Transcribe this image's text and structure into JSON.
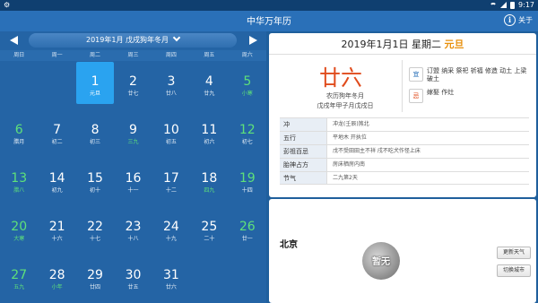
{
  "status_bar": {
    "left_icon": "settings-icon",
    "time": "9:17"
  },
  "header": {
    "title": "中华万年历",
    "about_label": "关于"
  },
  "calendar": {
    "month_label": "2019年1月 戊戌狗年冬月",
    "weekdays": [
      "周日",
      "周一",
      "周二",
      "周三",
      "周四",
      "周五",
      "周六"
    ],
    "weeks": [
      [
        null,
        null,
        {
          "day": "1",
          "sub": "元旦",
          "selected": true
        },
        {
          "day": "2",
          "sub": "廿七"
        },
        {
          "day": "3",
          "sub": "廿八"
        },
        {
          "day": "4",
          "sub": "廿九"
        },
        {
          "day": "5",
          "sub": "小寒",
          "term": true
        }
      ],
      [
        {
          "day": "6",
          "sub": "腊月"
        },
        {
          "day": "7",
          "sub": "初二"
        },
        {
          "day": "8",
          "sub": "初三"
        },
        {
          "day": "9",
          "sub": "三九",
          "term": true
        },
        {
          "day": "10",
          "sub": "初五"
        },
        {
          "day": "11",
          "sub": "初六"
        },
        {
          "day": "12",
          "sub": "初七"
        }
      ],
      [
        {
          "day": "13",
          "sub": "腊八",
          "term": true
        },
        {
          "day": "14",
          "sub": "初九"
        },
        {
          "day": "15",
          "sub": "初十"
        },
        {
          "day": "16",
          "sub": "十一"
        },
        {
          "day": "17",
          "sub": "十二"
        },
        {
          "day": "18",
          "sub": "四九",
          "term": true
        },
        {
          "day": "19",
          "sub": "十四"
        }
      ],
      [
        {
          "day": "20",
          "sub": "大寒",
          "term": true
        },
        {
          "day": "21",
          "sub": "十六"
        },
        {
          "day": "22",
          "sub": "十七"
        },
        {
          "day": "23",
          "sub": "十八"
        },
        {
          "day": "24",
          "sub": "十九"
        },
        {
          "day": "25",
          "sub": "二十"
        },
        {
          "day": "26",
          "sub": "廿一"
        }
      ],
      [
        {
          "day": "27",
          "sub": "五九",
          "term": true
        },
        {
          "day": "28",
          "sub": "小年",
          "term": true
        },
        {
          "day": "29",
          "sub": "廿四"
        },
        {
          "day": "30",
          "sub": "廿五"
        },
        {
          "day": "31",
          "sub": "廿六"
        },
        null,
        null
      ]
    ]
  },
  "detail": {
    "date": "2019年1月1日 星期二",
    "holiday": "元旦",
    "lunar_day": "廿六",
    "lunar_year": "农历狗年冬月",
    "ganzhi": "戊戌年甲子月戊戌日",
    "yi_label": "宜",
    "yi_text": "订盟 纳采 祭祀 祈福 修造 动土 上梁 破土",
    "ji_label": "忌",
    "ji_text": "嫁娶 作灶",
    "rows": [
      {
        "k": "冲",
        "v": "冲龙(壬辰)煞北"
      },
      {
        "k": "五行",
        "v": "平地木 开执位"
      },
      {
        "k": "彭祖百忌",
        "v": "戊不受田田主不祥 戌不吃犬作怪上床"
      },
      {
        "k": "胎神占方",
        "v": "房床栖房内南"
      },
      {
        "k": "节气",
        "v": "二九第2天"
      }
    ]
  },
  "weather": {
    "city": "北京",
    "moon_label": "暂无",
    "refresh_label": "更新天气",
    "switch_label": "切换城市"
  },
  "colors": {
    "accent": "#2a70b8",
    "selected": "#2aa3f0",
    "term_green": "#5ee07a",
    "holiday_orange": "#e8900c",
    "lunar_red": "#e04b1c"
  }
}
